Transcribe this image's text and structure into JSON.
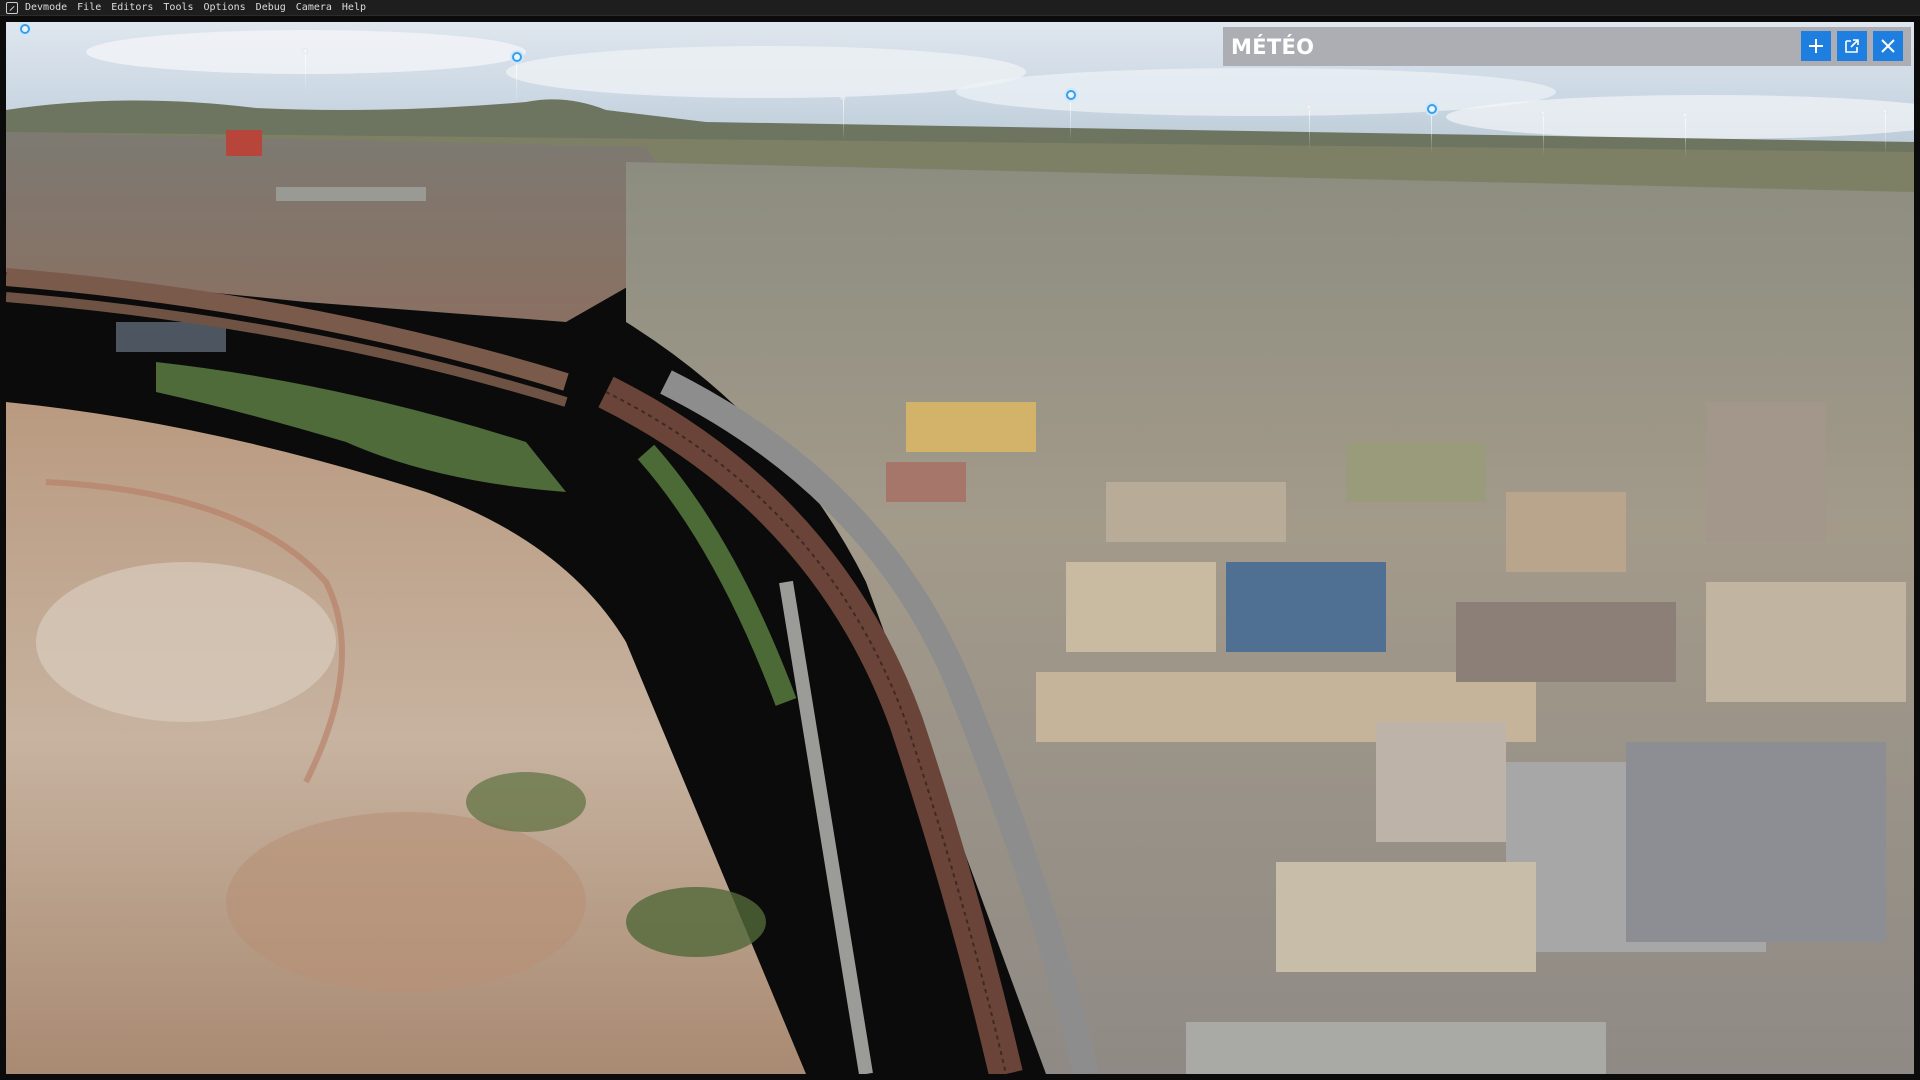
{
  "menubar": {
    "items": [
      {
        "label": "Devmode"
      },
      {
        "label": "File"
      },
      {
        "label": "Editors"
      },
      {
        "label": "Tools"
      },
      {
        "label": "Options"
      },
      {
        "label": "Debug"
      },
      {
        "label": "Camera"
      },
      {
        "label": "Help"
      }
    ]
  },
  "meteo_panel": {
    "title": "MÉTÉO",
    "accent": "#1f7fe0",
    "buttons": [
      {
        "icon": "plus-icon"
      },
      {
        "icon": "external-link-icon"
      },
      {
        "icon": "close-icon"
      }
    ]
  },
  "viewport": {
    "scene": "aerial-photogrammetry-city-view",
    "pins": [
      {
        "icon": "location-pin-icon"
      },
      {
        "icon": "location-pin-icon"
      },
      {
        "icon": "location-pin-icon"
      },
      {
        "icon": "location-pin-icon"
      },
      {
        "icon": "location-pin-icon"
      }
    ]
  }
}
